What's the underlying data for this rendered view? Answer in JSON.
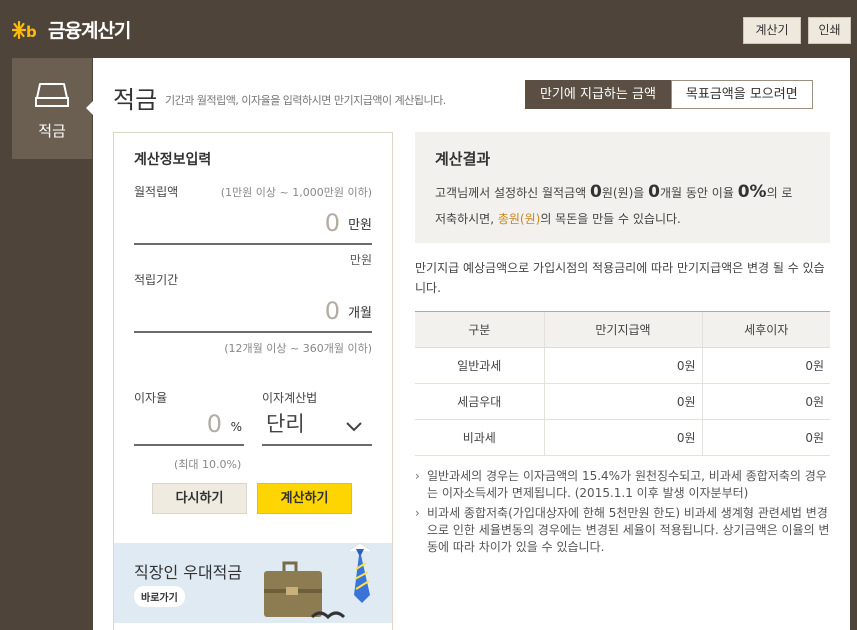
{
  "header": {
    "logo_text": "금융계산기",
    "buttons": {
      "calculator": "계산기",
      "print": "인쇄"
    }
  },
  "sidenav": {
    "active_label": "적금"
  },
  "page": {
    "title": "적금",
    "description": "기간과 월적립액, 이자율을 입력하시면 만기지급액이 계산됩니다.",
    "tabs": [
      "만기에 지급하는 금액",
      "목표금액을 모으려면"
    ]
  },
  "input_panel": {
    "title": "계산정보입력",
    "monthly": {
      "label": "월적립액",
      "hint": "(1만원 이상 ~ 1,000만원 이하)",
      "value": "0",
      "unit": "만원",
      "sub": "만원"
    },
    "period": {
      "label": "적립기간",
      "value": "0",
      "unit": "개월",
      "hint": "(12개월 이상 ~ 360개월 이하)"
    },
    "rate": {
      "label": "이자율",
      "value": "0",
      "unit": "%",
      "hint": "(최대 10.0%)"
    },
    "method": {
      "label": "이자계산법",
      "value": "단리"
    },
    "buttons": {
      "reset": "다시하기",
      "submit": "계산하기"
    },
    "banner": {
      "title": "직장인 우대적금",
      "link": "바로가기"
    }
  },
  "result": {
    "title": "계산결과",
    "line1_prefix": "고객님께서 설정하신 월적금액",
    "monthly_amount": "0",
    "line1_mid1": "원(원)을",
    "months": "0",
    "line1_mid2": "개월 동안 이율",
    "rate": "0%",
    "line1_suffix": "의 로",
    "line2_prefix": "저축하시면,",
    "total": "총원(원)",
    "line2_suffix": "의 목돈을 만들 수 있습니다.",
    "note": "만기지급 예상금액으로 가입시점의 적용금리에 따라 만기지급액은 변경 될 수 있습니다."
  },
  "table": {
    "headers": [
      "구분",
      "만기지급액",
      "세후이자"
    ],
    "rows": [
      [
        "일반과세",
        "0원",
        "0원"
      ],
      [
        "세금우대",
        "0원",
        "0원"
      ],
      [
        "비과세",
        "0원",
        "0원"
      ]
    ]
  },
  "notes": [
    "일반과세의 경우는 이자금액의 15.4%가 원천징수되고, 비과세 종합저축의 경우는 이자소득세가 면제됩니다. (2015.1.1 이후 발생 이자분부터)",
    "비과세 종합저축(가입대상자에 한해 5천만원 한도) 비과세 생계형 관련세법 변경으로 인한 세율변동의 경우에는 변경된 세율이 적용됩니다. 상기금액은 이율의 변동에 따라 차이가 있을 수 있습니다."
  ],
  "colors": {
    "brand_yellow": "#ffd500",
    "header_brown": "#4f4439",
    "accent_gold": "#c9861f"
  }
}
